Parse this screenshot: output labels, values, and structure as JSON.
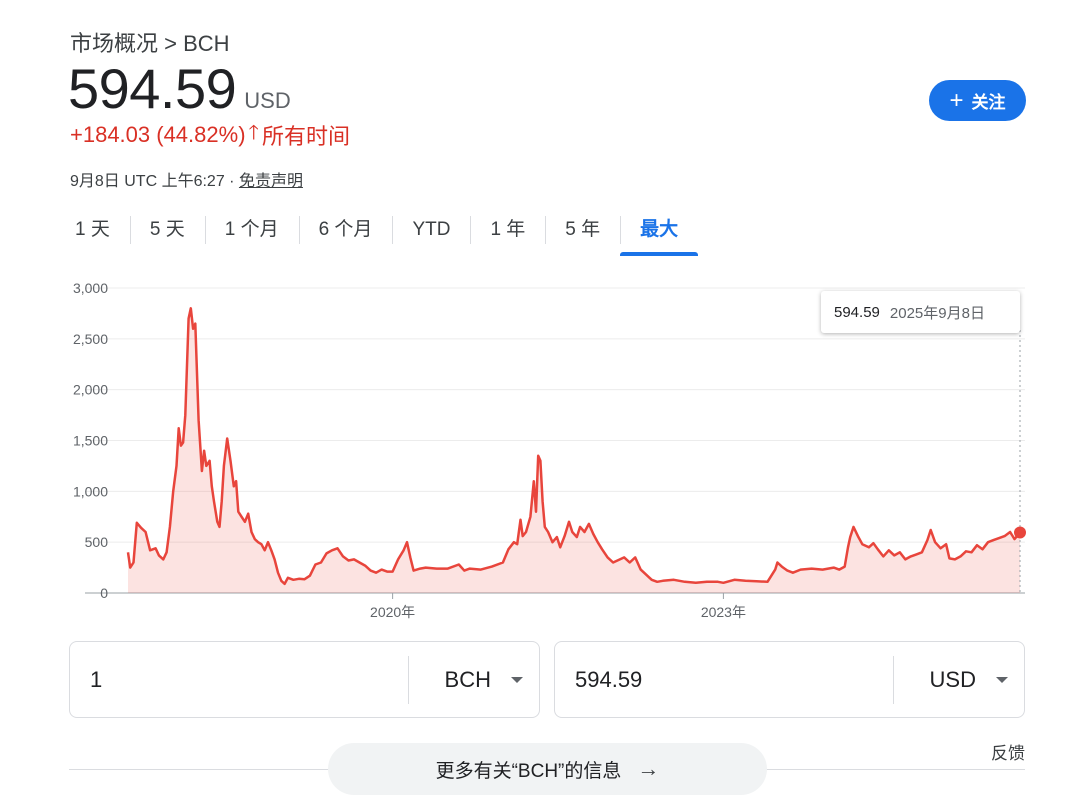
{
  "header": {
    "breadcrumb": "市场概况 > BCH",
    "price": "594.59",
    "currency": "USD",
    "change": "+184.03 (44.82%)",
    "change_arrow": "🡑",
    "change_period": "所有时间",
    "timestamp": "9月8日 UTC 上午6:27 · ",
    "disclaimer": "免责声明",
    "follow_label": "关注",
    "follow_icon": "+"
  },
  "tabs": [
    {
      "label": "1 天"
    },
    {
      "label": "5 天"
    },
    {
      "label": "1 个月"
    },
    {
      "label": "6 个月"
    },
    {
      "label": "YTD"
    },
    {
      "label": "1 年"
    },
    {
      "label": "5 年"
    },
    {
      "label": "最大",
      "active": true
    }
  ],
  "tooltip": {
    "value": "594.59",
    "date": "2025年9月8日"
  },
  "colors": {
    "line": "#e8453c",
    "fill": "rgba(234,67,53,0.15)",
    "accent": "#1a73e8",
    "grid": "#ececec"
  },
  "chart_data": {
    "type": "line",
    "ylim": [
      0,
      3000
    ],
    "yticks": [
      0,
      500,
      1000,
      1500,
      2000,
      2500,
      3000
    ],
    "ytick_labels": [
      "0",
      "500",
      "1,000",
      "1,500",
      "2,000",
      "2,500",
      "3,000"
    ],
    "xticks": [
      {
        "label": "2020年",
        "x": 2020.0
      },
      {
        "label": "2023年",
        "x": 2023.0
      }
    ],
    "xlim": [
      2017.6,
      2025.69
    ],
    "series": [
      {
        "points": [
          [
            2017.6,
            400
          ],
          [
            2017.62,
            250
          ],
          [
            2017.65,
            300
          ],
          [
            2017.68,
            690
          ],
          [
            2017.72,
            640
          ],
          [
            2017.76,
            600
          ],
          [
            2017.8,
            420
          ],
          [
            2017.85,
            440
          ],
          [
            2017.88,
            370
          ],
          [
            2017.92,
            330
          ],
          [
            2017.95,
            400
          ],
          [
            2017.98,
            650
          ],
          [
            2018.01,
            1000
          ],
          [
            2018.04,
            1250
          ],
          [
            2018.06,
            1620
          ],
          [
            2018.08,
            1450
          ],
          [
            2018.1,
            1480
          ],
          [
            2018.12,
            1750
          ],
          [
            2018.15,
            2700
          ],
          [
            2018.17,
            2800
          ],
          [
            2018.19,
            2600
          ],
          [
            2018.21,
            2650
          ],
          [
            2018.24,
            1700
          ],
          [
            2018.27,
            1200
          ],
          [
            2018.29,
            1400
          ],
          [
            2018.31,
            1250
          ],
          [
            2018.34,
            1300
          ],
          [
            2018.36,
            1050
          ],
          [
            2018.38,
            900
          ],
          [
            2018.41,
            700
          ],
          [
            2018.43,
            650
          ],
          [
            2018.45,
            900
          ],
          [
            2018.47,
            1250
          ],
          [
            2018.5,
            1520
          ],
          [
            2018.53,
            1300
          ],
          [
            2018.56,
            1050
          ],
          [
            2018.58,
            1100
          ],
          [
            2018.6,
            800
          ],
          [
            2018.63,
            750
          ],
          [
            2018.66,
            700
          ],
          [
            2018.69,
            780
          ],
          [
            2018.72,
            600
          ],
          [
            2018.75,
            530
          ],
          [
            2018.78,
            500
          ],
          [
            2018.81,
            480
          ],
          [
            2018.84,
            420
          ],
          [
            2018.87,
            500
          ],
          [
            2018.9,
            420
          ],
          [
            2018.93,
            330
          ],
          [
            2018.96,
            200
          ],
          [
            2018.99,
            120
          ],
          [
            2019.02,
            90
          ],
          [
            2019.05,
            150
          ],
          [
            2019.1,
            130
          ],
          [
            2019.15,
            140
          ],
          [
            2019.2,
            135
          ],
          [
            2019.25,
            170
          ],
          [
            2019.3,
            280
          ],
          [
            2019.35,
            300
          ],
          [
            2019.4,
            390
          ],
          [
            2019.45,
            420
          ],
          [
            2019.5,
            440
          ],
          [
            2019.55,
            360
          ],
          [
            2019.6,
            320
          ],
          [
            2019.65,
            330
          ],
          [
            2019.7,
            300
          ],
          [
            2019.75,
            270
          ],
          [
            2019.8,
            220
          ],
          [
            2019.85,
            200
          ],
          [
            2019.9,
            230
          ],
          [
            2019.95,
            210
          ],
          [
            2020.0,
            210
          ],
          [
            2020.05,
            330
          ],
          [
            2020.1,
            420
          ],
          [
            2020.13,
            500
          ],
          [
            2020.16,
            350
          ],
          [
            2020.19,
            220
          ],
          [
            2020.25,
            240
          ],
          [
            2020.3,
            250
          ],
          [
            2020.4,
            240
          ],
          [
            2020.5,
            240
          ],
          [
            2020.6,
            280
          ],
          [
            2020.65,
            220
          ],
          [
            2020.7,
            240
          ],
          [
            2020.8,
            230
          ],
          [
            2020.9,
            260
          ],
          [
            2021.0,
            300
          ],
          [
            2021.05,
            430
          ],
          [
            2021.1,
            500
          ],
          [
            2021.13,
            480
          ],
          [
            2021.16,
            720
          ],
          [
            2021.18,
            560
          ],
          [
            2021.21,
            600
          ],
          [
            2021.25,
            750
          ],
          [
            2021.28,
            1100
          ],
          [
            2021.3,
            800
          ],
          [
            2021.32,
            1350
          ],
          [
            2021.34,
            1300
          ],
          [
            2021.36,
            900
          ],
          [
            2021.38,
            650
          ],
          [
            2021.41,
            600
          ],
          [
            2021.45,
            500
          ],
          [
            2021.49,
            550
          ],
          [
            2021.52,
            450
          ],
          [
            2021.56,
            560
          ],
          [
            2021.6,
            700
          ],
          [
            2021.63,
            600
          ],
          [
            2021.67,
            550
          ],
          [
            2021.7,
            650
          ],
          [
            2021.74,
            600
          ],
          [
            2021.78,
            680
          ],
          [
            2021.82,
            580
          ],
          [
            2021.86,
            500
          ],
          [
            2021.9,
            430
          ],
          [
            2021.95,
            350
          ],
          [
            2022.0,
            300
          ],
          [
            2022.1,
            350
          ],
          [
            2022.15,
            300
          ],
          [
            2022.2,
            350
          ],
          [
            2022.25,
            230
          ],
          [
            2022.3,
            180
          ],
          [
            2022.35,
            130
          ],
          [
            2022.4,
            110
          ],
          [
            2022.45,
            120
          ],
          [
            2022.55,
            130
          ],
          [
            2022.65,
            110
          ],
          [
            2022.75,
            100
          ],
          [
            2022.85,
            110
          ],
          [
            2022.95,
            110
          ],
          [
            2023.0,
            100
          ],
          [
            2023.1,
            130
          ],
          [
            2023.2,
            120
          ],
          [
            2023.3,
            115
          ],
          [
            2023.4,
            110
          ],
          [
            2023.47,
            230
          ],
          [
            2023.49,
            300
          ],
          [
            2023.53,
            260
          ],
          [
            2023.58,
            220
          ],
          [
            2023.63,
            200
          ],
          [
            2023.7,
            230
          ],
          [
            2023.8,
            240
          ],
          [
            2023.9,
            230
          ],
          [
            2023.95,
            240
          ],
          [
            2024.0,
            250
          ],
          [
            2024.05,
            230
          ],
          [
            2024.1,
            260
          ],
          [
            2024.13,
            450
          ],
          [
            2024.15,
            550
          ],
          [
            2024.18,
            650
          ],
          [
            2024.22,
            560
          ],
          [
            2024.26,
            480
          ],
          [
            2024.32,
            450
          ],
          [
            2024.36,
            490
          ],
          [
            2024.4,
            430
          ],
          [
            2024.45,
            360
          ],
          [
            2024.5,
            420
          ],
          [
            2024.55,
            370
          ],
          [
            2024.6,
            400
          ],
          [
            2024.65,
            330
          ],
          [
            2024.7,
            360
          ],
          [
            2024.75,
            380
          ],
          [
            2024.8,
            400
          ],
          [
            2024.85,
            520
          ],
          [
            2024.88,
            620
          ],
          [
            2024.92,
            500
          ],
          [
            2024.97,
            440
          ],
          [
            2025.02,
            480
          ],
          [
            2025.05,
            340
          ],
          [
            2025.1,
            330
          ],
          [
            2025.15,
            360
          ],
          [
            2025.2,
            410
          ],
          [
            2025.25,
            400
          ],
          [
            2025.3,
            470
          ],
          [
            2025.35,
            430
          ],
          [
            2025.4,
            500
          ],
          [
            2025.45,
            520
          ],
          [
            2025.5,
            540
          ],
          [
            2025.55,
            560
          ],
          [
            2025.6,
            600
          ],
          [
            2025.64,
            530
          ],
          [
            2025.69,
            594.59
          ]
        ]
      }
    ]
  },
  "converter": {
    "left_value": "1",
    "left_currency": "BCH",
    "right_value": "594.59",
    "right_currency": "USD"
  },
  "footer": {
    "feedback": "反馈",
    "more_info": "更多有关“BCH”的信息",
    "more_arrow": "→"
  }
}
